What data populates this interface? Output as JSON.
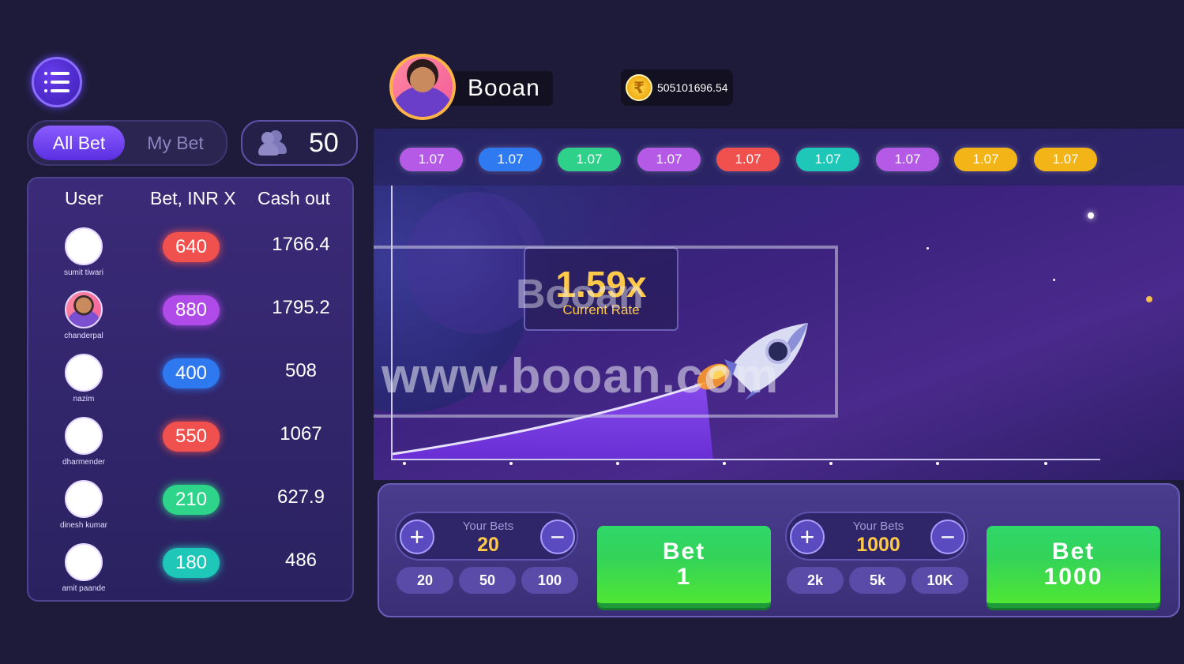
{
  "menu": {
    "icon": "menu-icon"
  },
  "tabs": {
    "all_bet": "All Bet",
    "my_bet": "My Bet"
  },
  "players": {
    "icon": "users-icon",
    "count": "50"
  },
  "table": {
    "headers": [
      "User",
      "Bet, INR X",
      "Cash out"
    ],
    "rows": [
      {
        "user": "sumit tiwari",
        "bet": "640",
        "cashout": "1766.4",
        "pill_color": "#f0514f"
      },
      {
        "user": "chanderpal",
        "bet": "880",
        "cashout": "1795.2",
        "pill_color": "#b04ae8"
      },
      {
        "user": "nazim",
        "bet": "400",
        "cashout": "508",
        "pill_color": "#2f79f0"
      },
      {
        "user": "dharmender",
        "bet": "550",
        "cashout": "1067",
        "pill_color": "#f0514f"
      },
      {
        "user": "dinesh kumar",
        "bet": "210",
        "cashout": "627.9",
        "pill_color": "#2ed48a"
      },
      {
        "user": "amit paande",
        "bet": "180",
        "cashout": "486",
        "pill_color": "#1fc7b8"
      }
    ]
  },
  "header": {
    "username": "Booan",
    "balance": "505101696.54",
    "coin_icon": "rupee-coin-icon"
  },
  "rates": [
    {
      "label": "1.07",
      "color": "#b45ae6"
    },
    {
      "label": "1.07",
      "color": "#2f7af0"
    },
    {
      "label": "1.07",
      "color": "#2fd08a"
    },
    {
      "label": "1.07",
      "color": "#b45ae6"
    },
    {
      "label": "1.07",
      "color": "#f0514f"
    },
    {
      "label": "1.07",
      "color": "#1fc7b8"
    },
    {
      "label": "1.07",
      "color": "#b45ae6"
    },
    {
      "label": "1.07",
      "color": "#f2b416"
    },
    {
      "label": "1.07",
      "color": "#f2b416"
    }
  ],
  "game": {
    "rate_value": "1.59x",
    "rate_label": "Current Rate"
  },
  "watermark": {
    "line1": "Booan",
    "line2": "www.booan.com"
  },
  "bet_left": {
    "label": "Your Bets",
    "value": "20",
    "quick": [
      "20",
      "50",
      "100"
    ],
    "button_line1": "Bet",
    "button_line2": "1"
  },
  "bet_right": {
    "label": "Your Bets",
    "value": "1000",
    "quick": [
      "2k",
      "5k",
      "10K"
    ],
    "button_line1": "Bet",
    "button_line2": "1000"
  },
  "symbols": {
    "plus": "+",
    "minus": "−"
  }
}
